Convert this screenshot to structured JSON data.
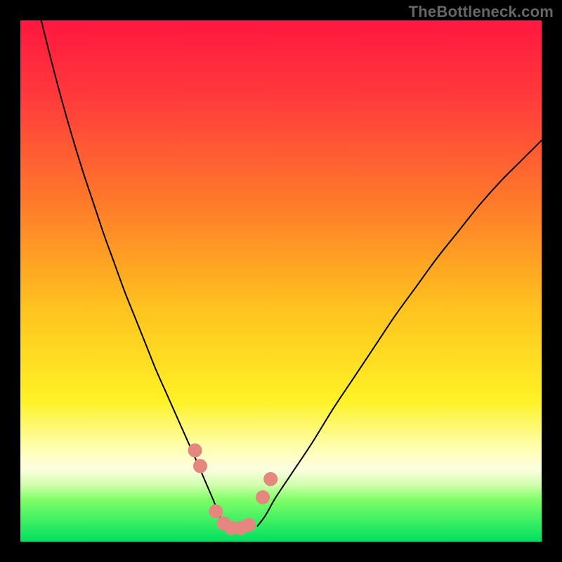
{
  "watermark": "TheBottleneck.com",
  "chart_data": {
    "type": "line",
    "title": "",
    "xlabel": "",
    "ylabel": "",
    "xlim": [
      0,
      100
    ],
    "ylim": [
      0,
      100
    ],
    "gradient_background": {
      "description": "vertical gradient from red at top through orange and yellow to pale yellow then bright green at bottom",
      "stops": [
        {
          "offset": 0.0,
          "color": "#ff173f"
        },
        {
          "offset": 0.15,
          "color": "#ff3b3b"
        },
        {
          "offset": 0.35,
          "color": "#ff7a2a"
        },
        {
          "offset": 0.55,
          "color": "#ffc21e"
        },
        {
          "offset": 0.73,
          "color": "#fff226"
        },
        {
          "offset": 0.82,
          "color": "#ffffb0"
        },
        {
          "offset": 0.86,
          "color": "#fdffe0"
        },
        {
          "offset": 0.89,
          "color": "#d4ffb0"
        },
        {
          "offset": 0.92,
          "color": "#7dff66"
        },
        {
          "offset": 1.0,
          "color": "#00e060"
        }
      ]
    },
    "series": [
      {
        "name": "curve-left",
        "stroke": "#000000",
        "stroke_width": 2,
        "x": [
          4,
          6,
          8,
          10,
          12,
          14,
          16,
          18,
          20,
          22,
          24,
          26,
          28,
          30,
          32,
          34,
          35.5,
          37,
          38.2,
          39.2
        ],
        "y": [
          100,
          92,
          84.5,
          77.5,
          71,
          65,
          59,
          53.5,
          48,
          43,
          38,
          33,
          28.5,
          24,
          19.5,
          15,
          11.5,
          8,
          5,
          3
        ]
      },
      {
        "name": "curve-right",
        "stroke": "#000000",
        "stroke_width": 2,
        "x": [
          45.5,
          47,
          49,
          52,
          56,
          60,
          64,
          68,
          72,
          76,
          80,
          84,
          88,
          92,
          96,
          100
        ],
        "y": [
          3,
          5,
          8.5,
          13,
          19,
          25.5,
          31.5,
          37.5,
          43.5,
          49,
          54.5,
          59.5,
          64.5,
          69,
          73,
          77
        ]
      },
      {
        "name": "pink-dots",
        "type": "scatter",
        "marker_color": "#e5877f",
        "marker_radius_px": 10,
        "x": [
          33.5,
          34.5,
          37.5,
          39,
          40.5,
          42.2,
          43.8,
          46.5,
          48
        ],
        "y": [
          17.5,
          14.5,
          5.8,
          3.5,
          2.6,
          2.6,
          3.2,
          8.5,
          12
        ]
      }
    ],
    "annotations": []
  }
}
